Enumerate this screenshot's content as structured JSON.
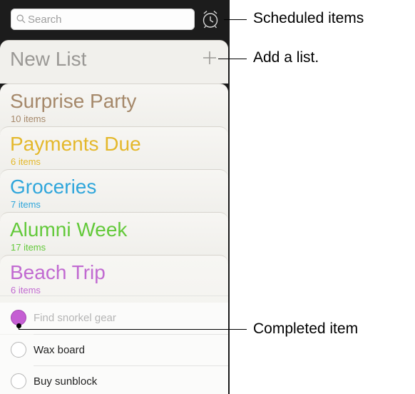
{
  "search": {
    "placeholder": "Search"
  },
  "new_list": {
    "label": "New List"
  },
  "lists": [
    {
      "name": "Surprise Party",
      "count": "10 items",
      "color": "#a5886a"
    },
    {
      "name": "Payments Due",
      "count": "6 items",
      "color": "#e4b82b"
    },
    {
      "name": "Groceries",
      "count": "7 items",
      "color": "#2fa6db"
    },
    {
      "name": "Alumni Week",
      "count": "17 items",
      "color": "#63c93a"
    },
    {
      "name": "Beach Trip",
      "count": "6 items",
      "color": "#c16ad1"
    }
  ],
  "beach_items": [
    {
      "label": "Find snorkel gear",
      "completed": true
    },
    {
      "label": "Wax board",
      "completed": false
    },
    {
      "label": "Buy sunblock",
      "completed": false
    }
  ],
  "callouts": {
    "scheduled": "Scheduled items",
    "add_list": "Add a list.",
    "completed": "Completed item"
  },
  "icons": {
    "search": "search-icon",
    "alarm": "alarm-clock-icon",
    "add": "plus-icon"
  }
}
